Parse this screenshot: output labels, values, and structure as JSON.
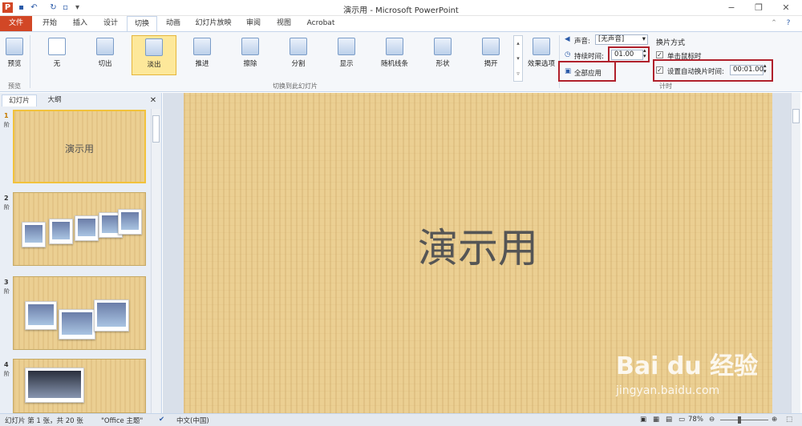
{
  "app": {
    "title": "演示用 - Microsoft PowerPoint"
  },
  "tabs": [
    "文件",
    "开始",
    "插入",
    "设计",
    "切换",
    "动画",
    "幻灯片放映",
    "审阅",
    "视图",
    "Acrobat"
  ],
  "ribbon": {
    "preview_label": "预览",
    "preview_group": "预览",
    "transitions": [
      "无",
      "切出",
      "淡出",
      "推进",
      "擦除",
      "分割",
      "显示",
      "随机线条",
      "形状",
      "揭开"
    ],
    "selected_transition": "淡出",
    "transitions_group": "切换到此幻灯片",
    "effect_options": "效果选项",
    "sound_label": "声音:",
    "sound_value": "[无声音]",
    "duration_label": "持续时间:",
    "duration_value": "01.00",
    "apply_all": "全部应用",
    "advance_title": "换片方式",
    "on_click": "单击鼠标时",
    "auto_advance": "设置自动换片时间:",
    "auto_advance_value": "00:01.00",
    "timing_group": "计时"
  },
  "panel": {
    "tab_slides": "幻灯片",
    "tab_outline": "大纲",
    "thumbnails": [
      {
        "number": "1",
        "title": "演示用"
      },
      {
        "number": "2"
      },
      {
        "number": "3"
      },
      {
        "number": "4"
      }
    ],
    "thumb_marker": "阶"
  },
  "slide": {
    "title": "演示用"
  },
  "status": {
    "slide_info": "幻灯片 第 1 张，共 20 张",
    "theme": "\"Office 主题\"",
    "language": "中文(中国)",
    "zoom": "78%"
  },
  "watermark": {
    "brand": "Bai du 经验",
    "url": "jingyan.baidu.com"
  }
}
